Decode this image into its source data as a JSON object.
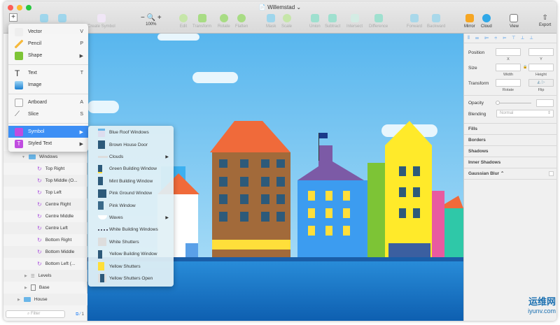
{
  "window": {
    "title": "Willemstad"
  },
  "toolbar": {
    "insert": "+",
    "create_symbol": "Create Symbol",
    "zoom": "100%",
    "items": [
      "Edit",
      "Transform",
      "Rotate",
      "Flatten",
      "Mask",
      "Scale",
      "Union",
      "Subtract",
      "Intersect",
      "Difference",
      "Forward",
      "Backward"
    ],
    "mirror": "Mirror",
    "cloud": "Cloud",
    "view": "View",
    "export": "Export"
  },
  "insert_menu": {
    "items": [
      {
        "label": "Vector",
        "shortcut": "V",
        "icon": "pen-icon"
      },
      {
        "label": "Pencil",
        "shortcut": "P",
        "icon": "pencil-icon"
      },
      {
        "label": "Shape",
        "shortcut": "▶",
        "icon": "shape-icon"
      },
      {
        "label": "Text",
        "shortcut": "T",
        "icon": "text-icon"
      },
      {
        "label": "Image",
        "shortcut": "",
        "icon": "image-icon"
      },
      {
        "label": "Artboard",
        "shortcut": "A",
        "icon": "artboard-icon"
      },
      {
        "label": "Slice",
        "shortcut": "S",
        "icon": "slice-icon"
      },
      {
        "label": "Symbol",
        "shortcut": "▶",
        "icon": "symbol-icon"
      },
      {
        "label": "Styled Text",
        "shortcut": "▶",
        "icon": "styled-text-icon"
      }
    ]
  },
  "symbol_submenu": {
    "items": [
      "Blue Roof Windows",
      "Brown House Door",
      "Clouds",
      "Green Building Window",
      "Mint Building Window",
      "Pink Ground Window",
      "Pink Window",
      "Waves",
      "White Building Windows",
      "White Shutters",
      "Yellow Building Window",
      "Yellow Shutters",
      "Yellow Shutters Open"
    ],
    "has_submenu": [
      "Clouds",
      "Waves"
    ]
  },
  "layers": {
    "windows": "Windows",
    "items": [
      "Top Right",
      "Top Middle (O...",
      "Top Left",
      "Centre Right",
      "Centre Middle",
      "Centre Left",
      "Bottom Right",
      "Bottom Middle",
      "Bottom Left (..."
    ],
    "levels": "Levels",
    "base": "Base",
    "house": "House",
    "filter_placeholder": "Filter",
    "count": "1"
  },
  "inspector": {
    "position": "Position",
    "x": "X",
    "y": "Y",
    "size": "Size",
    "width": "Width",
    "height": "Height",
    "transform": "Transform",
    "rotate": "Rotate",
    "flip": "Flip",
    "opacity": "Opacity",
    "blending": "Blending",
    "blending_value": "Normal",
    "sections": [
      "Fills",
      "Borders",
      "Shadows",
      "Inner Shadows",
      "Gaussian Blur ⌃"
    ]
  },
  "watermark": {
    "text": "运维网",
    "url": "iyunv.com"
  },
  "colors": {
    "accent": "#3d8ff5",
    "sky": "#8ccdf2",
    "water": "#1a7fd0",
    "symbol": "#b05ce0"
  }
}
